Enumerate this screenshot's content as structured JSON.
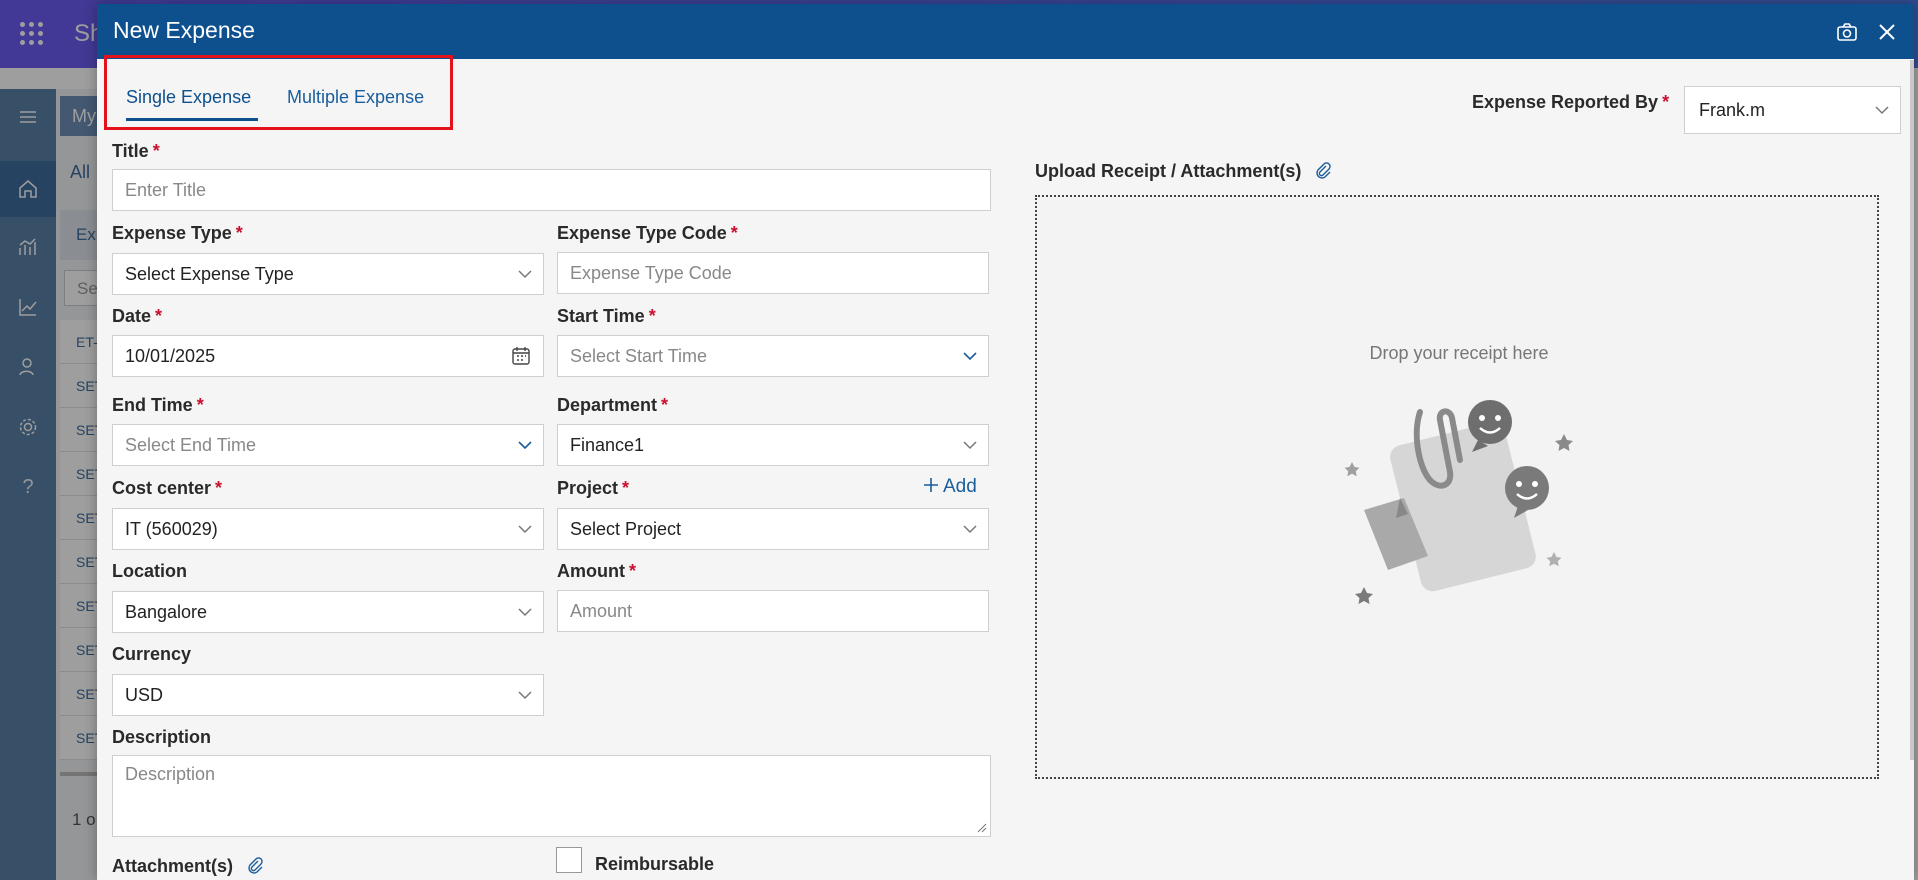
{
  "app": {
    "title": "Sh"
  },
  "background": {
    "header_label": "My",
    "all_tab": "All",
    "row_header": "Ex",
    "search_placeholder": "Se",
    "rows": [
      "ET-",
      "SET",
      "SET",
      "SET",
      "SET",
      "SET",
      "SET",
      "SET",
      "SET",
      "SET"
    ],
    "footer": "1 o"
  },
  "dialog": {
    "title": "New Expense",
    "tabs": [
      {
        "label": "Single Expense",
        "active": true
      },
      {
        "label": "Multiple Expense",
        "active": false
      }
    ],
    "reported_by": {
      "label": "Expense Reported By",
      "value": "Frank.m"
    },
    "title_field": {
      "label": "Title",
      "placeholder": "Enter Title"
    },
    "expense_type": {
      "label": "Expense Type",
      "value": "Select Expense Type"
    },
    "expense_type_code": {
      "label": "Expense Type Code",
      "placeholder": "Expense Type Code"
    },
    "date": {
      "label": "Date",
      "value": "10/01/2025"
    },
    "start_time": {
      "label": "Start Time",
      "value": "Select Start Time"
    },
    "end_time": {
      "label": "End Time",
      "value": "Select End Time"
    },
    "department": {
      "label": "Department",
      "value": "Finance1"
    },
    "cost_center": {
      "label": "Cost center",
      "value": "IT (560029)"
    },
    "project": {
      "label": "Project",
      "value": "Select Project",
      "add_label": "Add"
    },
    "location": {
      "label": "Location",
      "value": "Bangalore"
    },
    "amount": {
      "label": "Amount",
      "placeholder": "Amount"
    },
    "currency": {
      "label": "Currency",
      "value": "USD"
    },
    "description": {
      "label": "Description",
      "placeholder": "Description"
    },
    "attachments": {
      "label": "Attachment(s)"
    },
    "reimbursable": {
      "label": "Reimbursable",
      "checked": false
    },
    "upload": {
      "label": "Upload Receipt / Attachment(s)",
      "drop_text": "Drop your receipt here"
    },
    "required_mark": "*"
  },
  "colors": {
    "header": "#0e4f8e",
    "accent": "#1a5d9c",
    "required": "#c8102e",
    "highlight_box": "#e3121d"
  },
  "icons": [
    "camera-icon",
    "close-icon",
    "calendar-icon",
    "chevron-down-icon",
    "paperclip-icon",
    "plus-icon"
  ]
}
